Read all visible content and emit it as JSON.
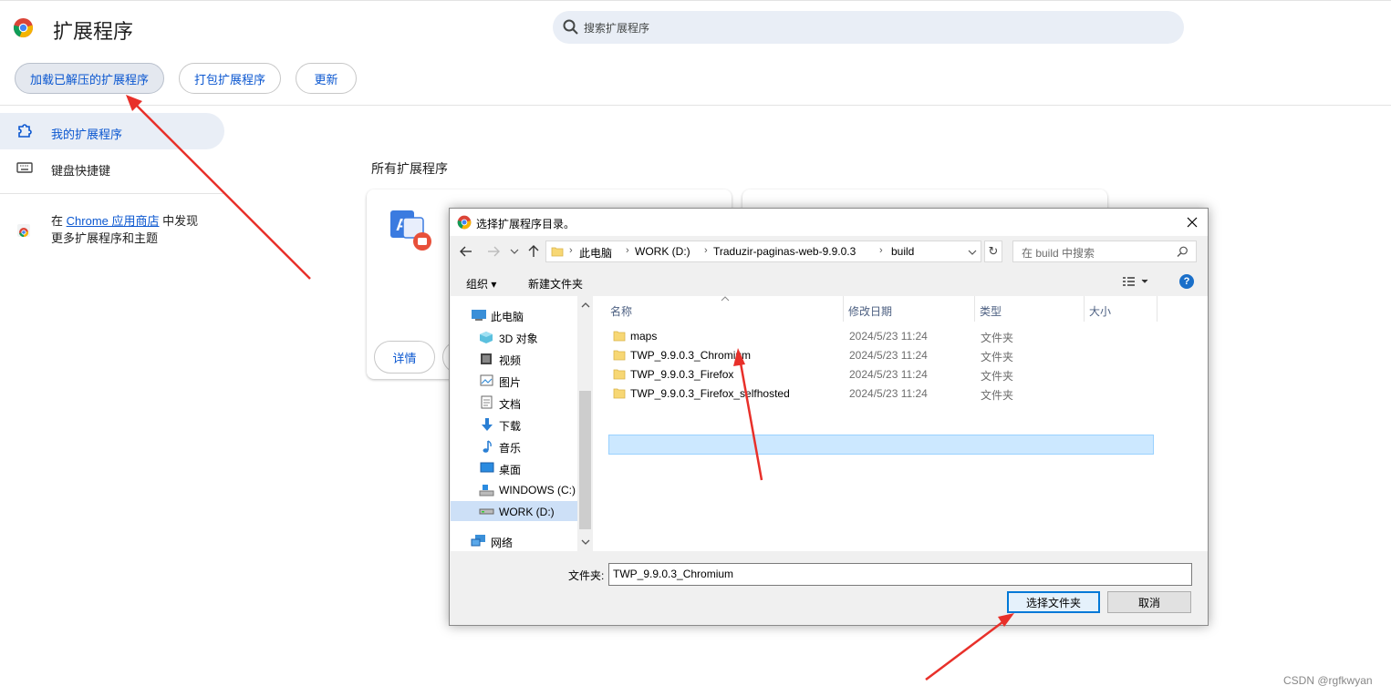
{
  "page": {
    "title": "扩展程序",
    "search_placeholder": "搜索扩展程序"
  },
  "toolbar": {
    "load_unpacked": "加载已解压的扩展程序",
    "pack": "打包扩展程序",
    "update": "更新"
  },
  "sidebar": {
    "items": [
      {
        "label": "我的扩展程序",
        "icon": "puzzle-icon",
        "active": true
      },
      {
        "label": "键盘快捷键",
        "icon": "keyboard-icon",
        "active": false
      }
    ],
    "store_prefix": "在",
    "store_link": "Chrome 应用商店",
    "store_suffix": "中发现",
    "store_line2": "更多扩展程序和主题"
  },
  "main": {
    "section_title": "所有扩展程序",
    "card1_details": "详情"
  },
  "dialog": {
    "title": "选择扩展程序目录。",
    "breadcrumb": [
      "此电脑",
      "WORK (D:)",
      "Traduzir-paginas-web-9.9.0.3",
      "build"
    ],
    "search_placeholder": "在 build 中搜索",
    "organize": "组织 ▾",
    "new_folder": "新建文件夹",
    "tree": [
      {
        "label": "此电脑",
        "icon": "computer-icon"
      },
      {
        "label": "3D 对象",
        "icon": "3d-objects-icon"
      },
      {
        "label": "视频",
        "icon": "video-icon"
      },
      {
        "label": "图片",
        "icon": "pictures-icon"
      },
      {
        "label": "文档",
        "icon": "documents-icon"
      },
      {
        "label": "下载",
        "icon": "download-icon"
      },
      {
        "label": "音乐",
        "icon": "music-icon"
      },
      {
        "label": "桌面",
        "icon": "desktop-icon"
      },
      {
        "label": "WINDOWS (C:)",
        "icon": "drive-icon"
      },
      {
        "label": "WORK (D:)",
        "icon": "drive-icon",
        "selected": true
      },
      {
        "label": "网络",
        "icon": "network-icon"
      }
    ],
    "columns": {
      "name": "名称",
      "date": "修改日期",
      "type": "类型",
      "size": "大小"
    },
    "files": [
      {
        "name": "maps",
        "date": "2024/5/23 11:24",
        "type": "文件夹"
      },
      {
        "name": "TWP_9.9.0.3_Chromium",
        "date": "2024/5/23 11:24",
        "type": "文件夹",
        "selected": true
      },
      {
        "name": "TWP_9.9.0.3_Firefox",
        "date": "2024/5/23 11:24",
        "type": "文件夹"
      },
      {
        "name": "TWP_9.9.0.3_Firefox_selfhosted",
        "date": "2024/5/23 11:24",
        "type": "文件夹"
      }
    ],
    "folder_label": "文件夹:",
    "folder_value": "TWP_9.9.0.3_Chromium",
    "select_button": "选择文件夹",
    "cancel_button": "取消"
  },
  "watermark": "CSDN @rgfkwyan",
  "colors": {
    "accent": "#0b57d0",
    "annotation_arrow": "#e8302a",
    "selection": "#cce8ff"
  }
}
